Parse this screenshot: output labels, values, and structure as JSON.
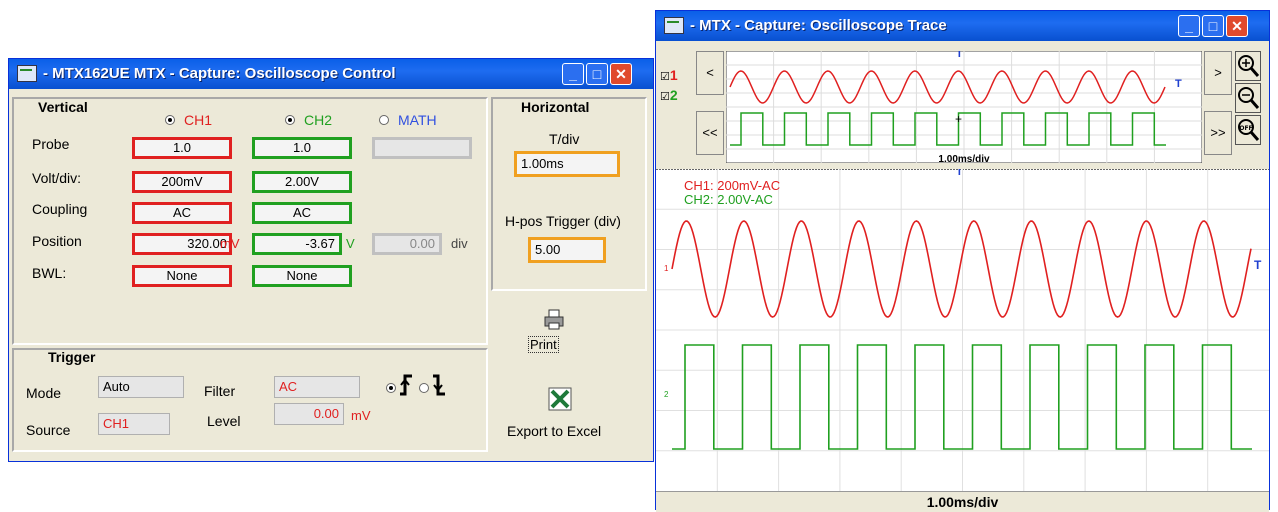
{
  "control_window": {
    "title": "- MTX162UE MTX - Capture: Oscilloscope Control",
    "vertical": {
      "heading": "Vertical",
      "ch1_label": "CH1",
      "ch2_label": "CH2",
      "math_label": "MATH",
      "probe_label": "Probe",
      "volt_label": "Volt/div:",
      "coupling_label": "Coupling",
      "position_label": "Position",
      "bwl_label": "BWL:",
      "ch1_probe": "1.0",
      "ch1_volt": "200mV",
      "ch1_coupling": "AC",
      "ch1_position": "320.00",
      "ch1_position_unit": "mV",
      "ch1_bwl": "None",
      "ch2_probe": "1.0",
      "ch2_volt": "2.00V",
      "ch2_coupling": "AC",
      "ch2_position": "-3.67",
      "ch2_position_unit": "V",
      "ch2_bwl": "None",
      "math_position": "0.00",
      "math_position_unit": "div"
    },
    "horizontal": {
      "heading": "Horizontal",
      "tdiv_label": "T/div",
      "tdiv_value": "1.00ms",
      "hpos_label": "H-pos Trigger (div)",
      "hpos_value": "5.00"
    },
    "trigger": {
      "heading": "Trigger",
      "mode_label": "Mode",
      "mode_value": "Auto",
      "source_label": "Source",
      "source_value": "CH1",
      "filter_label": "Filter",
      "filter_value": "AC",
      "level_label": "Level",
      "level_value": "0.00",
      "level_unit": "mV"
    },
    "print_label": "Print",
    "export_label": "Export to Excel"
  },
  "trace_window": {
    "title": "- MTX - Capture: Oscilloscope Trace",
    "ch1_check": "1",
    "ch2_check": "2",
    "nav_prev": "<",
    "nav_first": "<<",
    "nav_next": ">",
    "nav_last": ">>",
    "overview_timebase": "1.00ms/div",
    "legend_ch1": "CH1: 200mV-AC",
    "legend_ch2": "CH2: 2.00V-AC",
    "marker_ch1": "1",
    "marker_ch2": "2",
    "trigger_marker": "T",
    "timebase": "1.00ms/div"
  },
  "colors": {
    "ch1": "#e02020",
    "ch2": "#20a020",
    "titlebar": "#0a5fe8",
    "trigger_marker": "#2040d0"
  }
}
